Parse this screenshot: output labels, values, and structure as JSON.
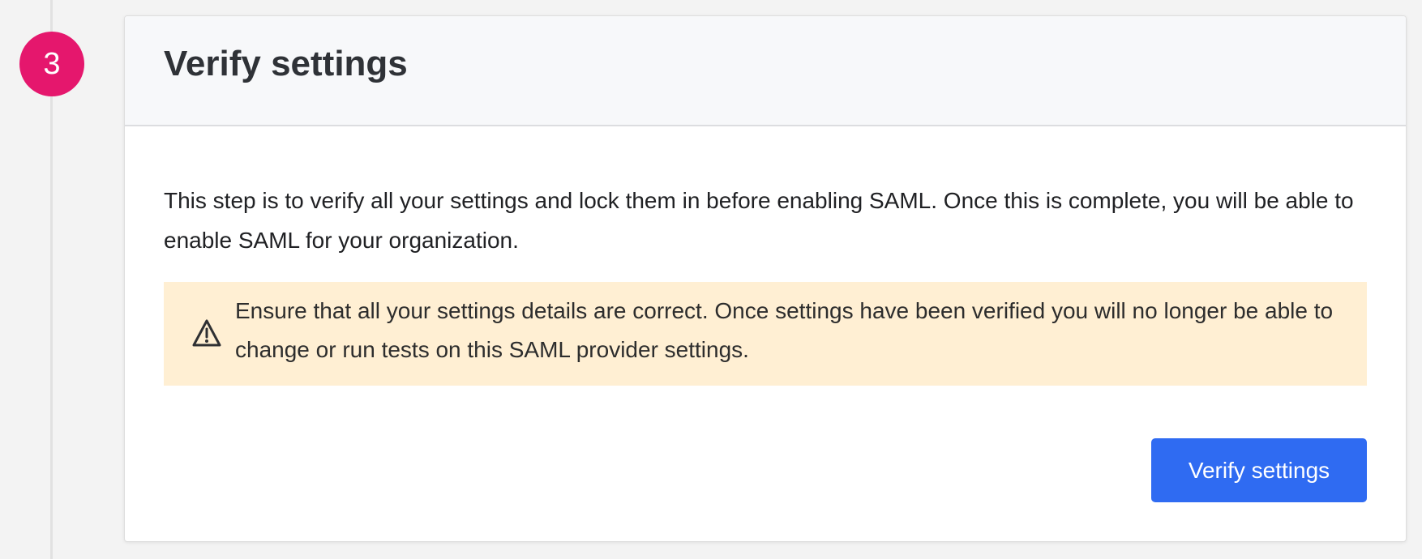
{
  "step": {
    "number": "3"
  },
  "card": {
    "title": "Verify settings",
    "description": "This step is to verify all your settings and lock them in before enabling SAML. Once this is complete, you will be able to enable SAML for your organization.",
    "alert": {
      "icon": "warning-icon",
      "text": "Ensure that all your settings details are correct. Once settings have been verified you will no longer be able to change or run tests on this SAML provider settings."
    },
    "button_label": "Verify settings"
  },
  "colors": {
    "step_badge": "#e5176d",
    "alert_background": "#ffefd3",
    "button_background": "#2f6bf2",
    "header_background": "#f7f8fa"
  }
}
